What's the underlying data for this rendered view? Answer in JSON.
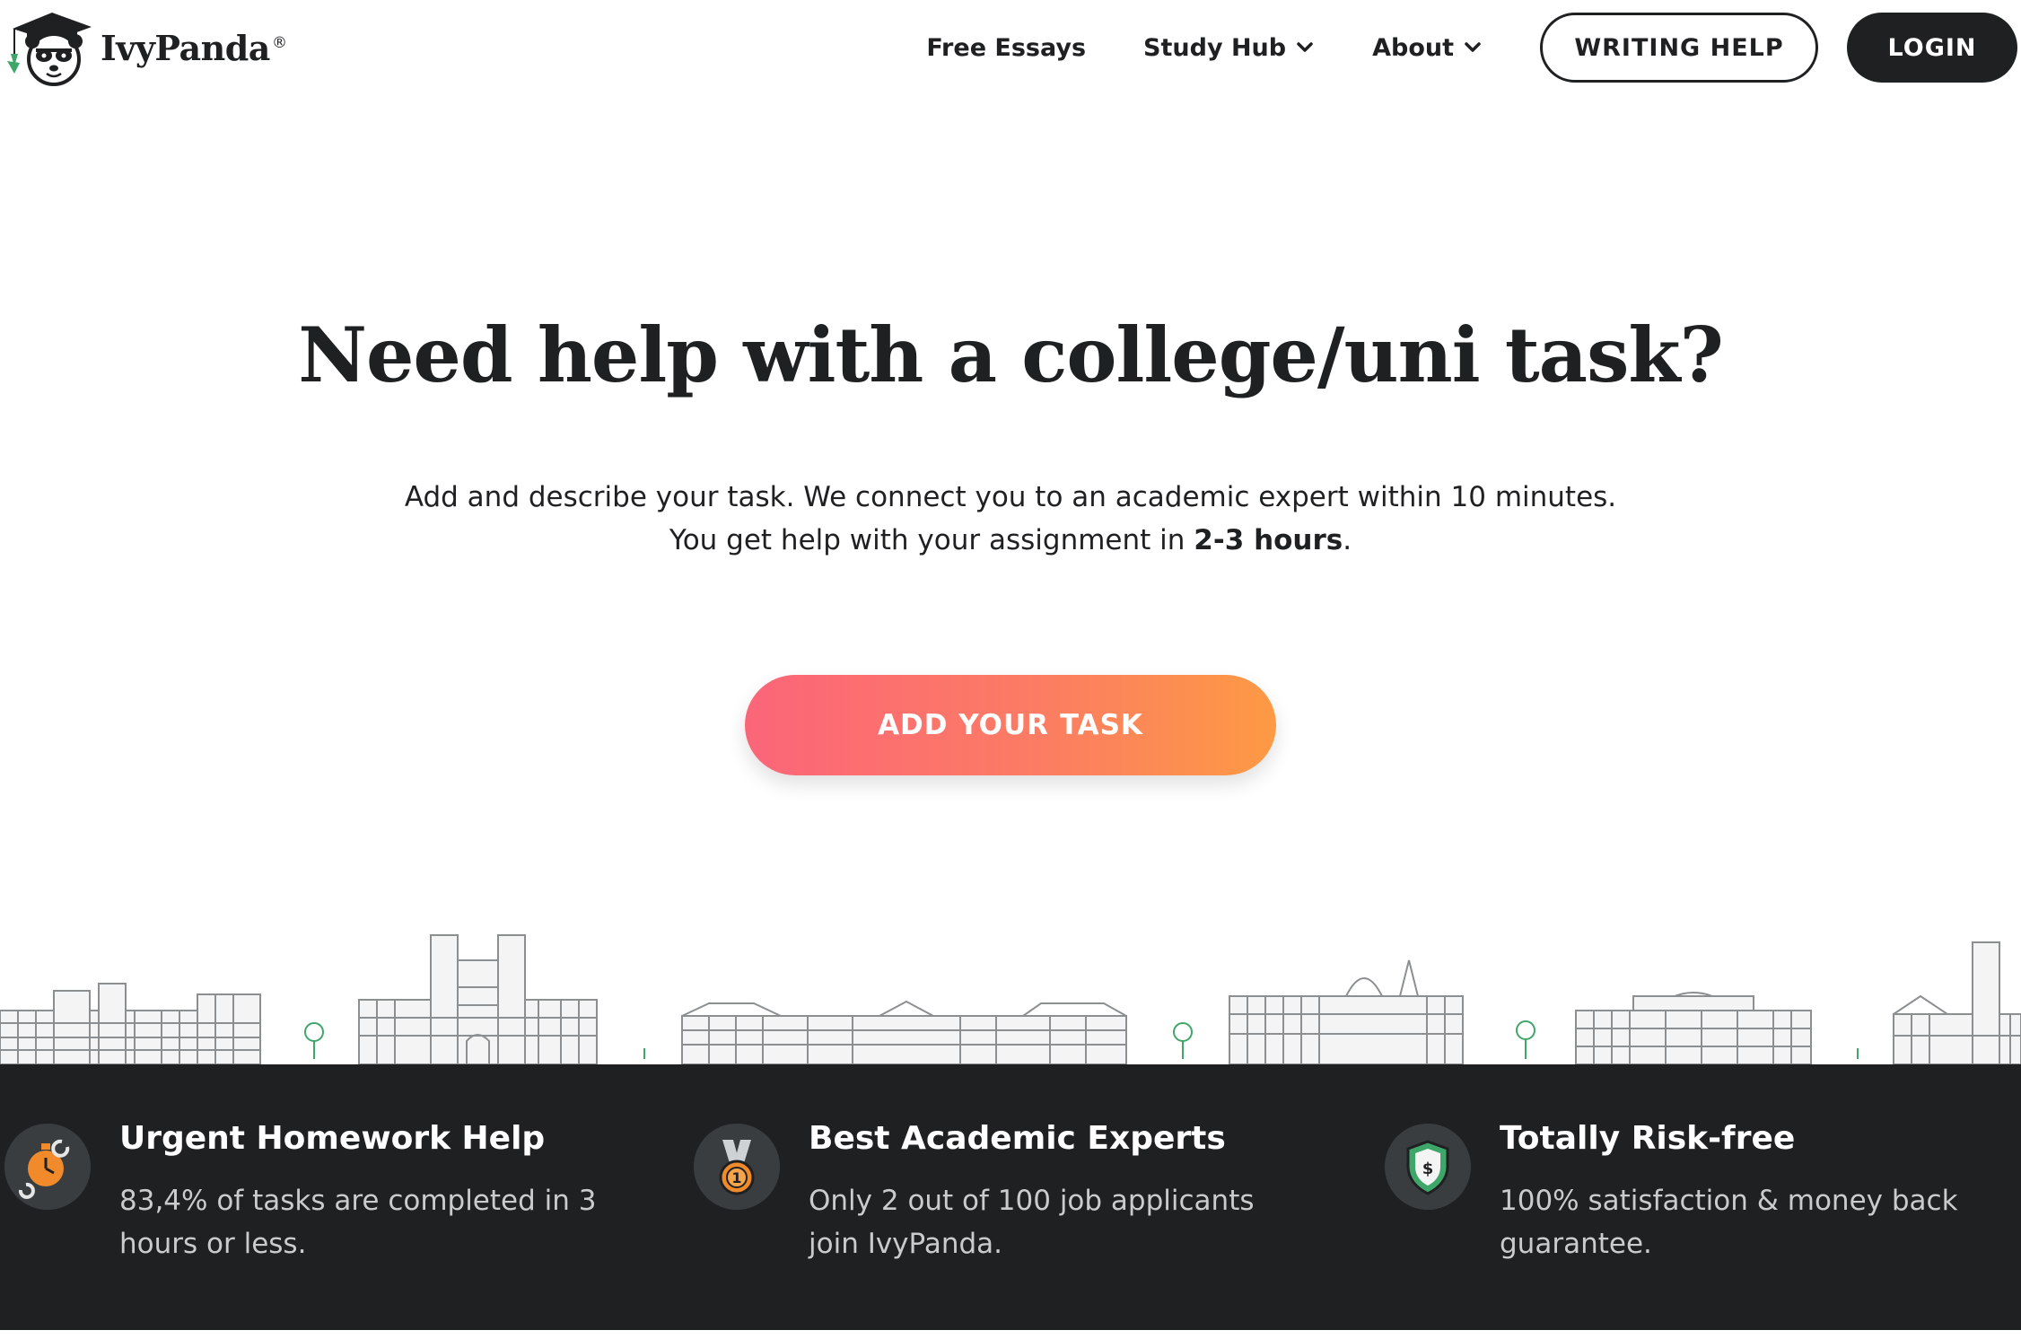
{
  "header": {
    "logo_text": "IvyPanda",
    "logo_reg": "®",
    "nav": {
      "free_essays": "Free Essays",
      "study_hub": "Study Hub",
      "about": "About"
    },
    "writing_help": "WRITING HELP",
    "login": "LOGIN"
  },
  "hero": {
    "title": "Need help with a college/uni task?",
    "subtitle_line1": "Add and describe your task. We connect you to an academic expert within 10 minutes.",
    "subtitle_line2_pre": "You get help with your assignment in ",
    "subtitle_line2_bold": "2-3 hours",
    "subtitle_line2_post": ".",
    "cta": "ADD YOUR TASK"
  },
  "features": [
    {
      "title": "Urgent Homework Help",
      "desc": "83,4% of tasks are completed in 3 hours or less.",
      "icon": "stopwatch-icon"
    },
    {
      "title": "Best Academic Experts",
      "desc": "Only 2 out of 100 job applicants join IvyPanda.",
      "icon": "medal-icon"
    },
    {
      "title": "Totally Risk-free",
      "desc": "100% satisfaction & money back guarantee.",
      "icon": "shield-dollar-icon"
    }
  ],
  "colors": {
    "dark": "#1e2022",
    "cta_start": "#fb6579",
    "cta_end": "#fd9a44",
    "accent_green": "#3fa66a",
    "icon_orange": "#f08a2a"
  }
}
